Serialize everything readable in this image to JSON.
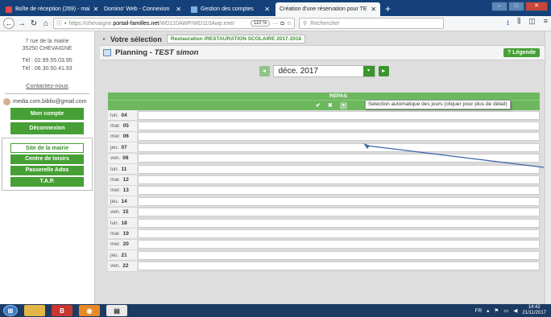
{
  "browser": {
    "tabs": [
      {
        "title": "Boîte de réception (269) - mai",
        "active": false
      },
      {
        "title": "Domino' Web - Connexion",
        "active": false
      },
      {
        "title": "Gestion des comptes",
        "active": false
      },
      {
        "title": "Création d'une réservation pour TE",
        "active": true
      }
    ],
    "url_prefix": "https://chevaigne.",
    "url_host": "portail-familles.net",
    "url_path": "/WD110AWP/WD110Awp.exe/",
    "zoom": "110 %",
    "search_placeholder": "Rechercher"
  },
  "sidebar": {
    "address_line1": "7 rue de la mairie",
    "address_line2": "35250 CHEVAIGNE",
    "phone": "Tél : 02.99.55.03.95",
    "fax": "Tél : 06.30.50.41.93",
    "contact": "Contactez-nous",
    "email": "media.com.biblio@gmail.com",
    "account_buttons": [
      "Mon compte",
      "Déconnexion"
    ],
    "site_link": "Site de la mairie",
    "services": [
      "Centre de loisirs",
      "Passerelle Ados",
      "T.A.P."
    ]
  },
  "main": {
    "selection_title": "Votre sélection",
    "selection_chip": "Restauration /RESTAURATION SCOLAIRE 2017-2018",
    "planning_title": "Planning - ",
    "planning_user": "TEST simon",
    "legend_button": "? Légende",
    "month": "déce. 2017",
    "column_header": "REPAS",
    "tooltip": "Selection automatique des jours (cliquer pour plus de détail)",
    "days": [
      {
        "dow": "lun.",
        "num": "04"
      },
      {
        "dow": "mar.",
        "num": "05"
      },
      {
        "dow": "mer.",
        "num": "06"
      },
      {
        "dow": "jeu.",
        "num": "07"
      },
      {
        "dow": "ven.",
        "num": "08"
      },
      {
        "dow": "lun.",
        "num": "11"
      },
      {
        "dow": "mar.",
        "num": "12"
      },
      {
        "dow": "mer.",
        "num": "13"
      },
      {
        "dow": "jeu.",
        "num": "14"
      },
      {
        "dow": "ven.",
        "num": "15"
      },
      {
        "dow": "lun.",
        "num": "18"
      },
      {
        "dow": "mar.",
        "num": "19"
      },
      {
        "dow": "mer.",
        "num": "20"
      },
      {
        "dow": "jeu.",
        "num": "21"
      },
      {
        "dow": "ven.",
        "num": "22"
      }
    ]
  },
  "taskbar": {
    "lang": "FR",
    "time": "14:42",
    "date": "21/11/2017"
  },
  "colors": {
    "accent_green": "#46a035",
    "grid_green": "#6db85f",
    "tab_bar": "#15417a"
  }
}
